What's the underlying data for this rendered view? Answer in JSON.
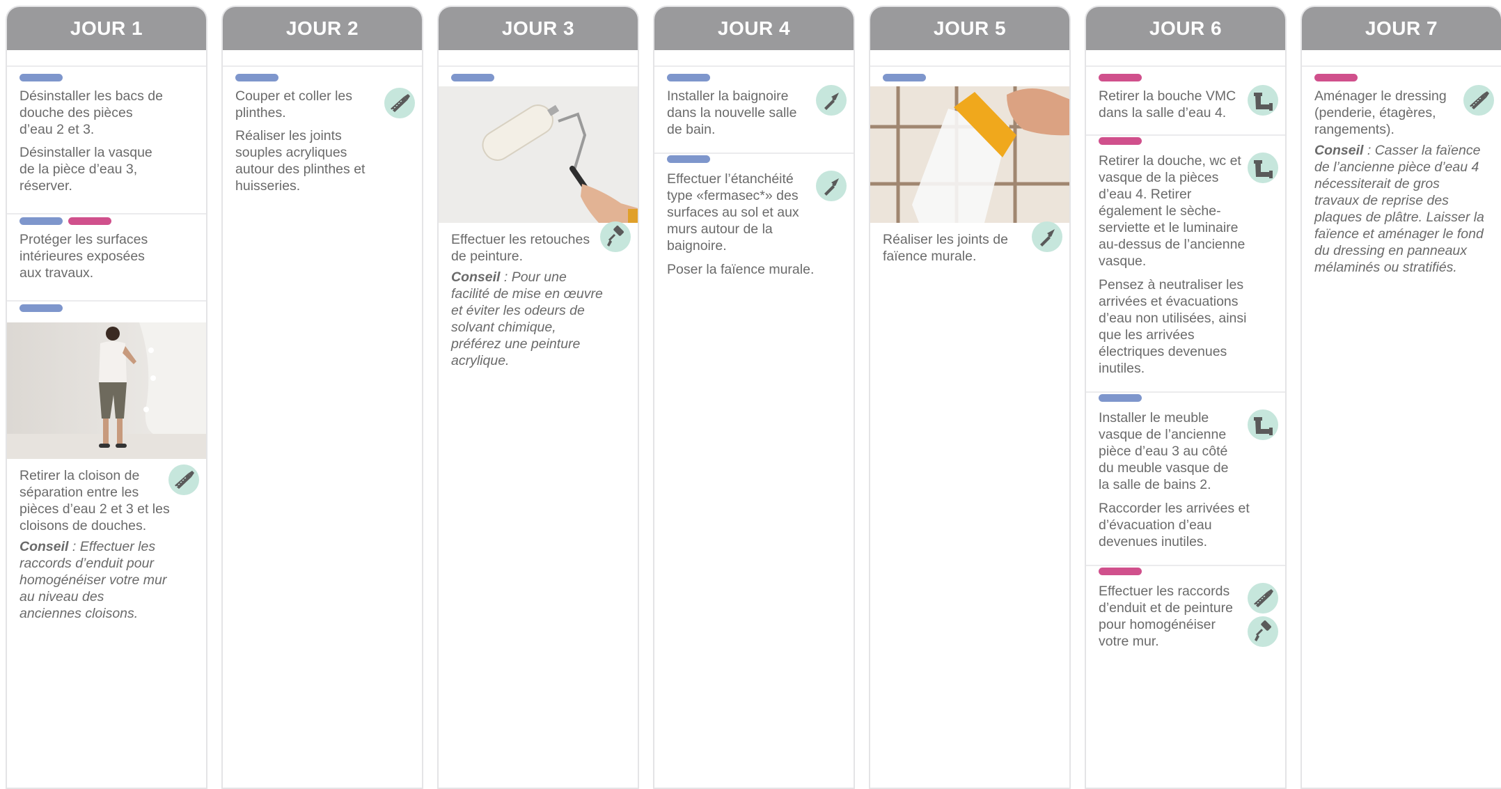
{
  "days": [
    {
      "title": "JOUR 1"
    },
    {
      "title": "JOUR 2"
    },
    {
      "title": "JOUR 3"
    },
    {
      "title": "JOUR 4"
    },
    {
      "title": "JOUR 5"
    },
    {
      "title": "JOUR 6"
    },
    {
      "title": "JOUR 7"
    }
  ],
  "colors": {
    "header": "#9a9a9c",
    "tag_blue": "#7e96cc",
    "tag_pink": "#d0508c",
    "icon_bg": "#c6e6dc",
    "icon_fg": "#5a5a5a"
  },
  "j1": {
    "t1a": "Désinstaller les bacs de douche des pièces d’eau 2 et 3.",
    "t1b": "Désinstaller la vasque de la pièce d’eau 3, réserver.",
    "t2": "Protéger les surfaces intérieures exposées aux travaux.",
    "t3": "Retirer la cloison de séparation entre les pièces d’eau 2 et 3 et les cloisons de douches.",
    "c_label": "Conseil",
    "c_text": " : Effectuer les raccords d’enduit pour homogénéiser votre mur au niveau des anciennes cloisons."
  },
  "j2": {
    "t1a": "Couper et coller les plinthes.",
    "t1b": "Réaliser les joints souples  acryliques autour des plinthes et huisseries."
  },
  "j3": {
    "t1": "Effectuer les retouches de peinture.",
    "c_label": "Conseil",
    "c_text": " : Pour une facilité de mise en œuvre et éviter les odeurs de solvant chimique, préférez une peinture acrylique."
  },
  "j4": {
    "t1": "Installer la baignoire dans la nouvelle salle de bain.",
    "t2a": "Effectuer l’étanchéité type «fermasec*» des surfaces au sol et aux murs autour de la baignoire.",
    "t2b": "Poser la faïence murale."
  },
  "j5": {
    "t1": "Réaliser les joints de faïence murale."
  },
  "j6": {
    "t1": "Retirer la bouche VMC dans la salle d’eau 4.",
    "t2a": "Retirer la douche, wc et vasque de la pièces d’eau 4. Retirer également le sèche-serviette et le luminaire au-dessus de l’ancienne vasque.",
    "t2b": "Pensez à neutraliser les arrivées et évacuations d’eau non utilisées, ainsi que les arrivées électriques devenues inutiles.",
    "t3a": "Installer le meuble vasque de l’ancienne pièce d’eau 3 au côté du meuble vasque de la salle de bains 2.",
    "t3b": "Raccorder les arrivées et d’évacuation d’eau devenues inutiles.",
    "t4": "Effectuer les raccords d’enduit et de peinture pour homogénéiser votre mur."
  },
  "j7": {
    "t1": "Aménager le dressing (penderie, étagères, rangements).",
    "c_label": "Conseil",
    "c_text": " : Casser la faïence de l’ancienne pièce d’eau 4 nécessiterait de gros travaux de reprise des plaques de plâtre. Laisser la faïence et aménager le fond du dressing en panneaux mélaminés ou stratifiés."
  },
  "icons": [
    "saw-icon",
    "trowel-icon",
    "paint-roller-icon",
    "plumbing-pipe-icon"
  ]
}
